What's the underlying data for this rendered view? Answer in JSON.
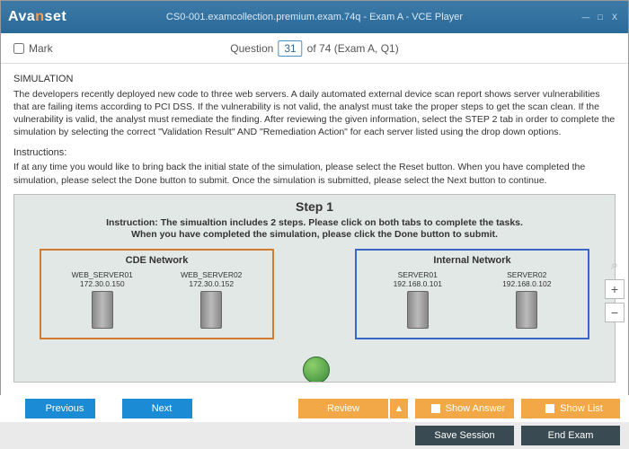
{
  "window": {
    "logo_pre": "Ava",
    "logo_n": "n",
    "logo_post": "set",
    "title": "CS0-001.examcollection.premium.exam.74q - Exam A - VCE Player",
    "min": "—",
    "max": "□",
    "close": "X"
  },
  "header": {
    "mark_label": "Mark",
    "q_word": "Question",
    "q_num": "31",
    "q_rest": "of 74 (Exam A, Q1)"
  },
  "question": {
    "title": "SIMULATION",
    "body": "The developers recently deployed new code to three web servers. A daily automated external device scan report shows server vulnerabilities that are failing items according to PCI DSS. If the vulnerability is not valid, the analyst must take the proper steps to get the scan clean. If the vulnerability is valid, the analyst must remediate the finding. After reviewing the given information, select the STEP 2 tab in order to complete the simulation by selecting the correct \"Validation Result\" AND \"Remediation Action\" for each server listed using the drop down options.",
    "instr_head": "Instructions:",
    "instr_body": "If at any time you would like to bring back the initial state of the simulation, please select the Reset button. When you have completed the simulation, please select the Done button to submit. Once the simulation is submitted, please select the Next button to continue."
  },
  "sim": {
    "step_title": "Step 1",
    "instr_l1": "Instruction: The simualtion includes 2 steps. Please click on both tabs to complete the tasks.",
    "instr_l2": "When you have completed the simulation, please click the Done button to submit.",
    "cde_label": "CDE Network",
    "int_label": "Internal Network",
    "servers_cde": [
      {
        "name": "WEB_SERVER01",
        "ip": "172.30.0.150"
      },
      {
        "name": "WEB_SERVER02",
        "ip": "172.30.0.152"
      }
    ],
    "servers_int": [
      {
        "name": "SERVER01",
        "ip": "192.168.0.101"
      },
      {
        "name": "SERVER02",
        "ip": "192.168.0.102"
      }
    ]
  },
  "zoom": {
    "plus": "+",
    "minus": "−"
  },
  "buttons": {
    "previous": "Previous",
    "next": "Next",
    "review": "Review",
    "review_tri": "▲",
    "show_answer": "Show Answer",
    "show_list": "Show List",
    "save_session": "Save Session",
    "end_exam": "End Exam"
  }
}
